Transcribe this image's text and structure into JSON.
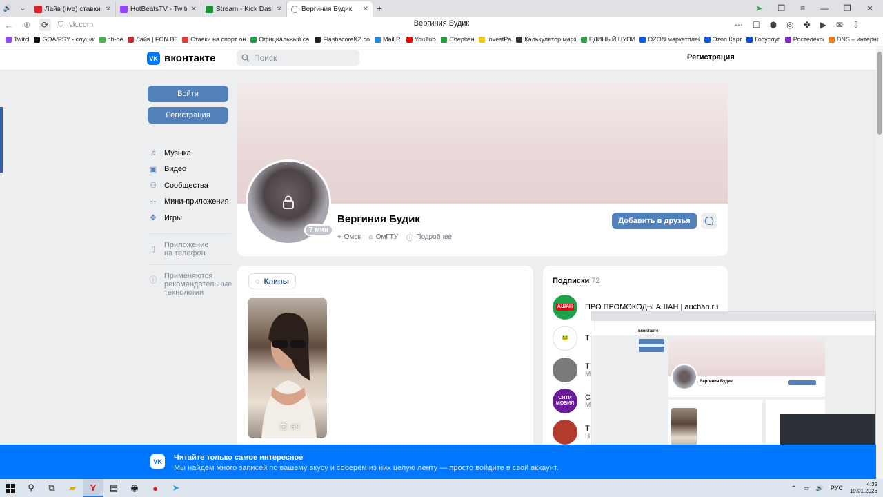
{
  "browser": {
    "tabs": [
      {
        "title": "Лайв (live) ставки на Хоккей",
        "color": "#d6232a",
        "active": false
      },
      {
        "title": "HotBeatsTV - Twitch",
        "color": "#9146ff",
        "active": false
      },
      {
        "title": "Stream - Kick Dashboard",
        "color": "#1a8f3c",
        "active": false
      },
      {
        "title": "Вергиния Будик",
        "color": "#0077ff",
        "active": true
      }
    ],
    "url": "vk.com",
    "page_title": "Вергиния Будик",
    "bookmarks": [
      {
        "label": "Twitch",
        "color": "#9146ff"
      },
      {
        "label": "GOA/PSY - слушать",
        "color": "#111111"
      },
      {
        "label": "nb-bet",
        "color": "#4caf50"
      },
      {
        "label": "Лайв | FON.BET",
        "color": "#d6232a"
      },
      {
        "label": "Ставки на спорт онлайн",
        "color": "#e53935"
      },
      {
        "label": "Официальный сайт",
        "color": "#1aa34a"
      },
      {
        "label": "FlashscoreKZ.com",
        "color": "#222222"
      },
      {
        "label": "Mail.Ru",
        "color": "#168de2"
      },
      {
        "label": "YouTube",
        "color": "#ff0000"
      },
      {
        "label": "Сбербанк",
        "color": "#21a038"
      },
      {
        "label": "InvestPay",
        "color": "#f5c518"
      },
      {
        "label": "Калькулятор маржи",
        "color": "#333333"
      },
      {
        "label": "ЕДИНЫЙ ЦУПИС",
        "color": "#2e9e44"
      },
      {
        "label": "OZON маркетплейс",
        "color": "#005bff"
      },
      {
        "label": "Ozon Карта",
        "color": "#005bff"
      },
      {
        "label": "Госуслуги",
        "color": "#0d4cd3"
      },
      {
        "label": "Ростелеком",
        "color": "#7b2cbf"
      },
      {
        "label": "DNS – интернет",
        "color": "#f57c00"
      }
    ]
  },
  "vk": {
    "logo": "вконтакте",
    "logo_badge": "VK",
    "search_placeholder": "Поиск",
    "header_register": "Регистрация",
    "sidebar": {
      "login": "Войти",
      "register": "Регистрация",
      "items": [
        {
          "label": "Музыка",
          "icon": "music-icon"
        },
        {
          "label": "Видео",
          "icon": "video-icon"
        },
        {
          "label": "Сообщества",
          "icon": "communities-icon"
        },
        {
          "label": "Мини-приложения",
          "icon": "mini-apps-icon"
        },
        {
          "label": "Игры",
          "icon": "games-icon"
        }
      ],
      "app_note": [
        "Приложение",
        "на телефон"
      ],
      "rec_note": [
        "Применяются",
        "рекомендательные",
        "технологии"
      ]
    },
    "profile": {
      "name": "Вергиния Будик",
      "last_seen": "7 мин",
      "city": "Омск",
      "university": "ОмГТУ",
      "more": "Подробнее",
      "add_friend": "Добавить в друзья"
    },
    "clips": {
      "label": "Клипы",
      "views": "69"
    },
    "subscriptions": {
      "title": "Подписки",
      "count": "72",
      "items": [
        {
          "name": "ПРО ПРОМОКОДЫ АШАН | auchan.ru",
          "sub": "",
          "color": "#1fa34a",
          "badge": "АШАН"
        },
        {
          "name": "Т",
          "sub": "",
          "color": "#ffffff",
          "badge": ""
        },
        {
          "name": "Т",
          "sub": "М",
          "color": "#7a7a7a",
          "badge": ""
        },
        {
          "name": "С",
          "sub": "М",
          "color": "#6a1b9a",
          "badge": "СИТИ МОБИЛ"
        },
        {
          "name": "Т",
          "sub": "Н",
          "color": "#b23b2e",
          "badge": ""
        }
      ]
    },
    "promo": {
      "title": "Читайте только самое интересное",
      "text": "Мы найдём много записей по вашему вкусу и соберём из них целую ленту — просто войдите в свой аккаунт."
    }
  },
  "taskbar": {
    "lang": "РУС",
    "time": "4:39",
    "date": "19.01.2026"
  },
  "colors": {
    "vk_blue": "#0077ff",
    "vk_button": "#5181b8",
    "page_bg": "#edeef0"
  }
}
